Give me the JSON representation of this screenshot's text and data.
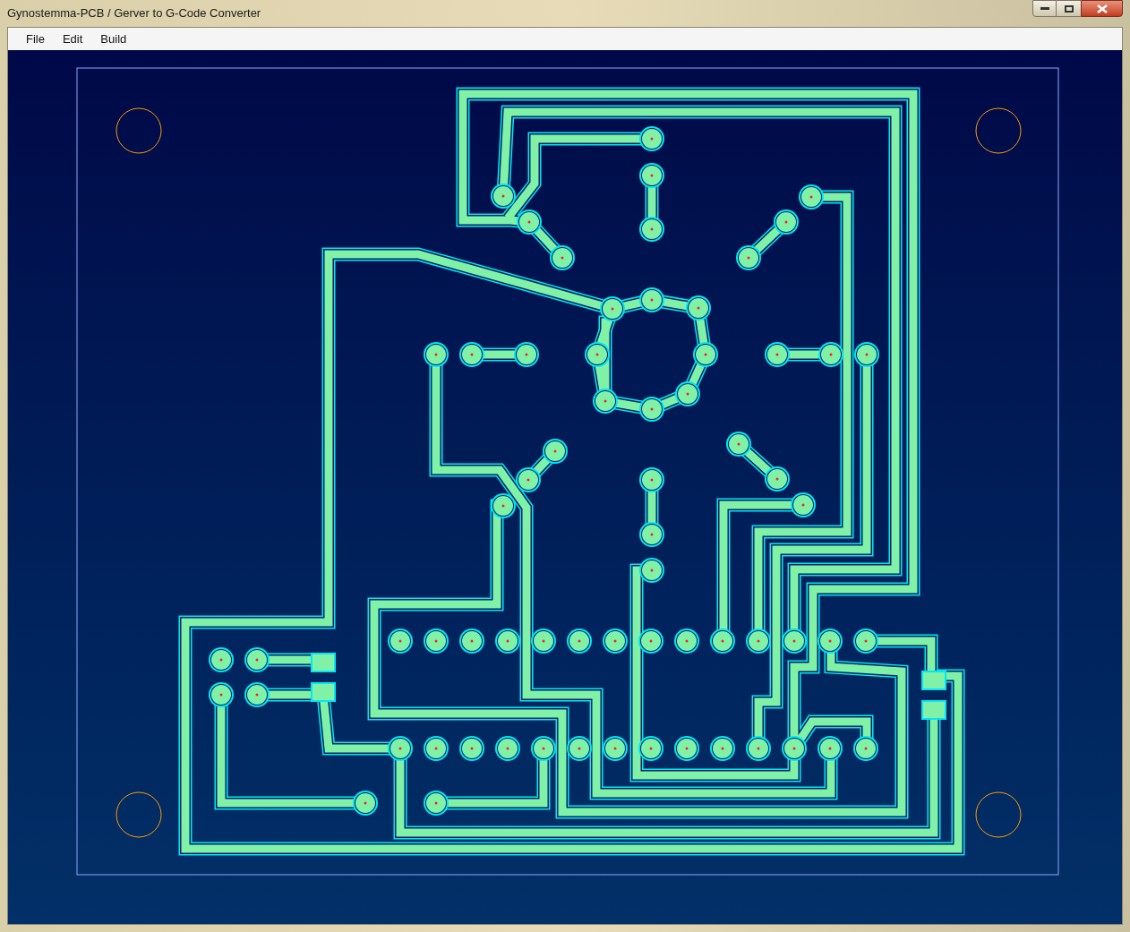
{
  "window": {
    "title": "Gynostemma-PCB / Gerver to G-Code Converter"
  },
  "menu": [
    {
      "label": "File"
    },
    {
      "label": "Edit"
    },
    {
      "label": "Build"
    }
  ]
}
